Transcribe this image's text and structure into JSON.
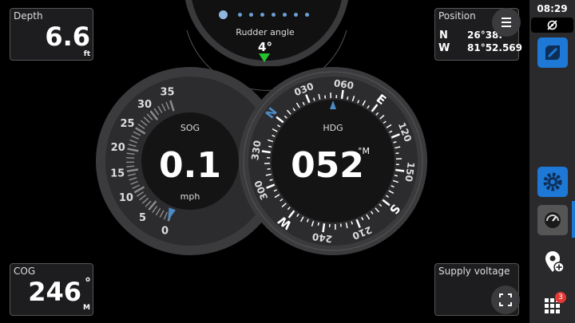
{
  "page_dots": {
    "count": 8,
    "active": 0
  },
  "depth": {
    "label": "Depth",
    "value": "6.6",
    "unit": "ft"
  },
  "position": {
    "label": "Position",
    "lat_hemi": "N",
    "lat": "26°38.",
    "lon_hemi": "W",
    "lon": "81°52.569"
  },
  "cog": {
    "label": "COG",
    "value": "246",
    "deg": "°",
    "ref": "M"
  },
  "supply": {
    "label": "Supply voltage"
  },
  "rudder": {
    "label": "Rudder angle",
    "value": "4°"
  },
  "sog": {
    "label": "SOG",
    "value": "0.1",
    "unit": "mph",
    "ticks": [
      "0",
      "5",
      "10",
      "15",
      "20",
      "25",
      "30",
      "35"
    ],
    "max": 35
  },
  "hdg": {
    "label": "HDG",
    "value": "052",
    "unit": "°M",
    "heading": 52,
    "labels": [
      "N",
      "030",
      "060",
      "E",
      "120",
      "150",
      "S",
      "210",
      "240",
      "W",
      "300",
      "330"
    ]
  },
  "status": {
    "time": "08:29"
  },
  "apps_badge": "3",
  "colors": {
    "accent": "#1e78d6",
    "green": "#22c52e",
    "badge": "#e53935"
  }
}
